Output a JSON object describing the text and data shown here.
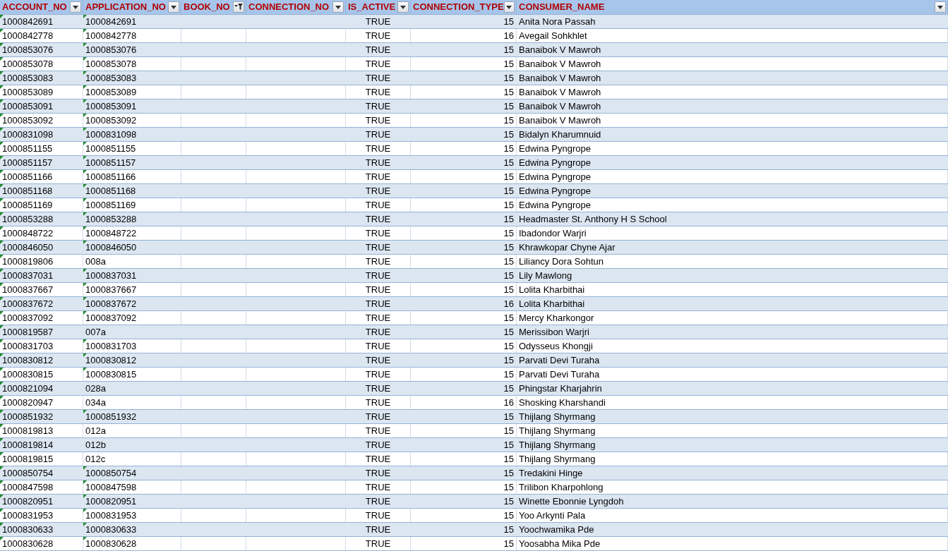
{
  "columns": [
    {
      "label": "ACCOUNT_NO",
      "filtered": false
    },
    {
      "label": "APPLICATION_NO",
      "filtered": false
    },
    {
      "label": "BOOK_NO",
      "filtered": true
    },
    {
      "label": "CONNECTION_NO",
      "filtered": false
    },
    {
      "label": "IS_ACTIVE",
      "filtered": false
    },
    {
      "label": "CONNECTION_TYPE",
      "filtered": false
    },
    {
      "label": "CONSUMER_NAME",
      "filtered": false
    }
  ],
  "rows": [
    {
      "account_no": "1000842691",
      "application_no": "1000842691",
      "is_active": "TRUE",
      "connection_type": "15",
      "consumer_name": "Anita Nora Passah",
      "account_flag": true,
      "application_flag": true
    },
    {
      "account_no": "1000842778",
      "application_no": "1000842778",
      "is_active": "TRUE",
      "connection_type": "16",
      "consumer_name": "Avegail Sohkhlet",
      "account_flag": true,
      "application_flag": true
    },
    {
      "account_no": "1000853076",
      "application_no": "1000853076",
      "is_active": "TRUE",
      "connection_type": "15",
      "consumer_name": "Banaibok V Mawroh",
      "account_flag": true,
      "application_flag": true
    },
    {
      "account_no": "1000853078",
      "application_no": "1000853078",
      "is_active": "TRUE",
      "connection_type": "15",
      "consumer_name": "Banaibok V Mawroh",
      "account_flag": true,
      "application_flag": true
    },
    {
      "account_no": "1000853083",
      "application_no": "1000853083",
      "is_active": "TRUE",
      "connection_type": "15",
      "consumer_name": "Banaibok V Mawroh",
      "account_flag": true,
      "application_flag": true
    },
    {
      "account_no": "1000853089",
      "application_no": "1000853089",
      "is_active": "TRUE",
      "connection_type": "15",
      "consumer_name": "Banaibok V Mawroh",
      "account_flag": true,
      "application_flag": true
    },
    {
      "account_no": "1000853091",
      "application_no": "1000853091",
      "is_active": "TRUE",
      "connection_type": "15",
      "consumer_name": "Banaibok V Mawroh",
      "account_flag": true,
      "application_flag": true
    },
    {
      "account_no": "1000853092",
      "application_no": "1000853092",
      "is_active": "TRUE",
      "connection_type": "15",
      "consumer_name": "Banaibok V Mawroh",
      "account_flag": true,
      "application_flag": true
    },
    {
      "account_no": "1000831098",
      "application_no": "1000831098",
      "is_active": "TRUE",
      "connection_type": "15",
      "consumer_name": "Bidalyn Kharumnuid",
      "account_flag": true,
      "application_flag": true
    },
    {
      "account_no": "1000851155",
      "application_no": "1000851155",
      "is_active": "TRUE",
      "connection_type": "15",
      "consumer_name": "Edwina Pyngrope",
      "account_flag": true,
      "application_flag": true
    },
    {
      "account_no": "1000851157",
      "application_no": "1000851157",
      "is_active": "TRUE",
      "connection_type": "15",
      "consumer_name": "Edwina Pyngrope",
      "account_flag": true,
      "application_flag": true
    },
    {
      "account_no": "1000851166",
      "application_no": "1000851166",
      "is_active": "TRUE",
      "connection_type": "15",
      "consumer_name": "Edwina Pyngrope",
      "account_flag": true,
      "application_flag": true
    },
    {
      "account_no": "1000851168",
      "application_no": "1000851168",
      "is_active": "TRUE",
      "connection_type": "15",
      "consumer_name": "Edwina Pyngrope",
      "account_flag": true,
      "application_flag": true
    },
    {
      "account_no": "1000851169",
      "application_no": "1000851169",
      "is_active": "TRUE",
      "connection_type": "15",
      "consumer_name": "Edwina Pyngrope",
      "account_flag": true,
      "application_flag": true
    },
    {
      "account_no": "1000853288",
      "application_no": "1000853288",
      "is_active": "TRUE",
      "connection_type": "15",
      "consumer_name": "Headmaster St. Anthony H S School",
      "account_flag": true,
      "application_flag": true
    },
    {
      "account_no": "1000848722",
      "application_no": "1000848722",
      "is_active": "TRUE",
      "connection_type": "15",
      "consumer_name": "Ibadondor Warjri",
      "account_flag": true,
      "application_flag": true
    },
    {
      "account_no": "1000846050",
      "application_no": "1000846050",
      "is_active": "TRUE",
      "connection_type": "15",
      "consumer_name": "Khrawkopar Chyne Ajar",
      "account_flag": true,
      "application_flag": true
    },
    {
      "account_no": "1000819806",
      "application_no": "008a",
      "is_active": "TRUE",
      "connection_type": "15",
      "consumer_name": "Liliancy Dora Sohtun",
      "account_flag": true,
      "application_flag": false
    },
    {
      "account_no": "1000837031",
      "application_no": "1000837031",
      "is_active": "TRUE",
      "connection_type": "15",
      "consumer_name": "Lily Mawlong",
      "account_flag": true,
      "application_flag": true
    },
    {
      "account_no": "1000837667",
      "application_no": "1000837667",
      "is_active": "TRUE",
      "connection_type": "15",
      "consumer_name": "Lolita Kharbithai",
      "account_flag": true,
      "application_flag": true
    },
    {
      "account_no": "1000837672",
      "application_no": "1000837672",
      "is_active": "TRUE",
      "connection_type": "16",
      "consumer_name": "Lolita Kharbithai",
      "account_flag": true,
      "application_flag": true
    },
    {
      "account_no": "1000837092",
      "application_no": "1000837092",
      "is_active": "TRUE",
      "connection_type": "15",
      "consumer_name": "Mercy Kharkongor",
      "account_flag": true,
      "application_flag": true
    },
    {
      "account_no": "1000819587",
      "application_no": "007a",
      "is_active": "TRUE",
      "connection_type": "15",
      "consumer_name": "Merissibon Warjri",
      "account_flag": true,
      "application_flag": false
    },
    {
      "account_no": "1000831703",
      "application_no": "1000831703",
      "is_active": "TRUE",
      "connection_type": "15",
      "consumer_name": "Odysseus Khongji",
      "account_flag": true,
      "application_flag": true
    },
    {
      "account_no": "1000830812",
      "application_no": "1000830812",
      "is_active": "TRUE",
      "connection_type": "15",
      "consumer_name": "Parvati Devi Turaha",
      "account_flag": true,
      "application_flag": true
    },
    {
      "account_no": "1000830815",
      "application_no": "1000830815",
      "is_active": "TRUE",
      "connection_type": "15",
      "consumer_name": "Parvati Devi Turaha",
      "account_flag": true,
      "application_flag": true
    },
    {
      "account_no": "1000821094",
      "application_no": "028a",
      "is_active": "TRUE",
      "connection_type": "15",
      "consumer_name": "Phingstar Kharjahrin",
      "account_flag": true,
      "application_flag": false
    },
    {
      "account_no": "1000820947",
      "application_no": "034a",
      "is_active": "TRUE",
      "connection_type": "16",
      "consumer_name": "Shosking Kharshandi",
      "account_flag": true,
      "application_flag": false
    },
    {
      "account_no": "1000851932",
      "application_no": "1000851932",
      "is_active": "TRUE",
      "connection_type": "15",
      "consumer_name": "Thijlang Shyrmang",
      "account_flag": true,
      "application_flag": true
    },
    {
      "account_no": "1000819813",
      "application_no": "012a",
      "is_active": "TRUE",
      "connection_type": "15",
      "consumer_name": "Thijlang Shyrmang",
      "account_flag": true,
      "application_flag": false
    },
    {
      "account_no": "1000819814",
      "application_no": "012b",
      "is_active": "TRUE",
      "connection_type": "15",
      "consumer_name": "Thijlang Shyrmang",
      "account_flag": true,
      "application_flag": false
    },
    {
      "account_no": "1000819815",
      "application_no": "012c",
      "is_active": "TRUE",
      "connection_type": "15",
      "consumer_name": "Thijlang Shyrmang",
      "account_flag": true,
      "application_flag": false
    },
    {
      "account_no": "1000850754",
      "application_no": "1000850754",
      "is_active": "TRUE",
      "connection_type": "15",
      "consumer_name": "Tredakini Hinge",
      "account_flag": true,
      "application_flag": true
    },
    {
      "account_no": "1000847598",
      "application_no": "1000847598",
      "is_active": "TRUE",
      "connection_type": "15",
      "consumer_name": "Trilibon Kharpohlong",
      "account_flag": true,
      "application_flag": true
    },
    {
      "account_no": "1000820951",
      "application_no": "1000820951",
      "is_active": "TRUE",
      "connection_type": "15",
      "consumer_name": "Winette Ebonnie Lyngdoh",
      "account_flag": true,
      "application_flag": true
    },
    {
      "account_no": "1000831953",
      "application_no": "1000831953",
      "is_active": "TRUE",
      "connection_type": "15",
      "consumer_name": "Yoo Arkynti Pala",
      "account_flag": true,
      "application_flag": true
    },
    {
      "account_no": "1000830633",
      "application_no": "1000830633",
      "is_active": "TRUE",
      "connection_type": "15",
      "consumer_name": "Yoochwamika Pde",
      "account_flag": true,
      "application_flag": true
    },
    {
      "account_no": "1000830628",
      "application_no": "1000830628",
      "is_active": "TRUE",
      "connection_type": "15",
      "consumer_name": "Yoosabha Mika Pde",
      "account_flag": true,
      "application_flag": true
    }
  ]
}
